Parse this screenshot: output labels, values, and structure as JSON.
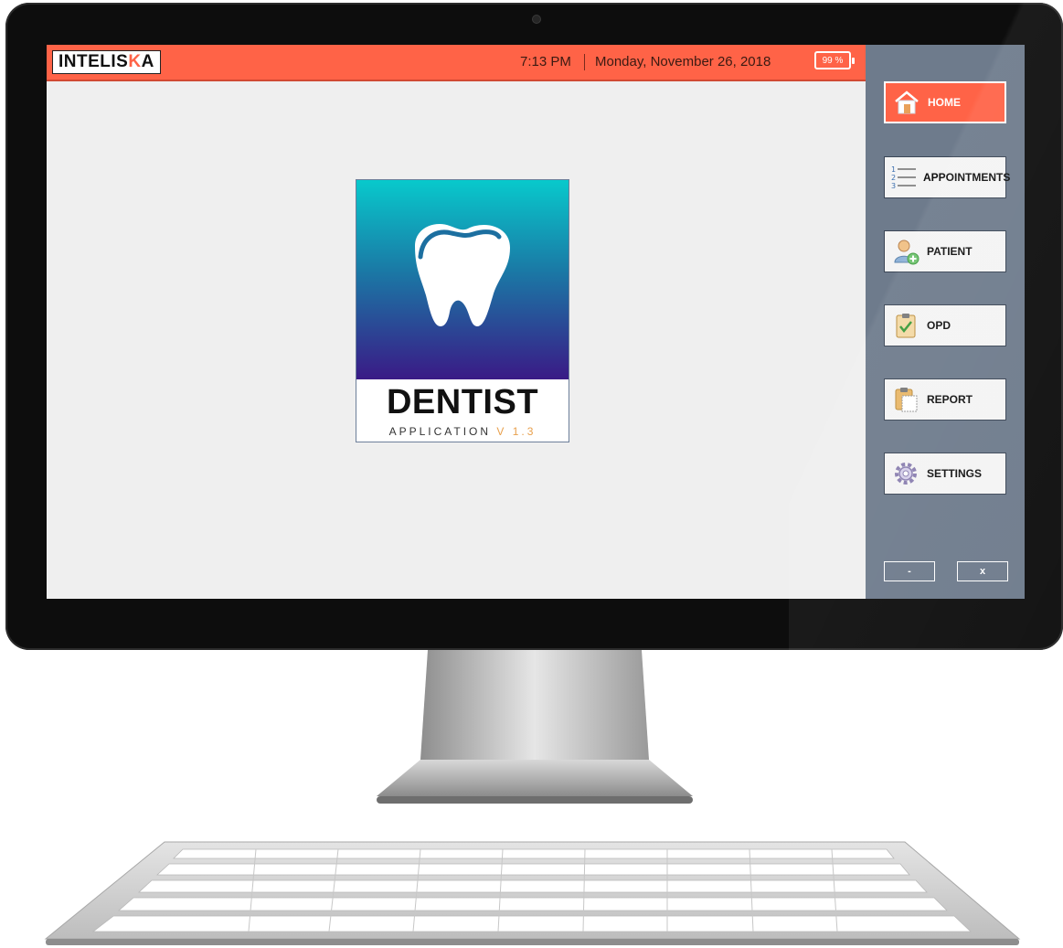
{
  "topbar": {
    "brand": "INTELISKA",
    "brand_prefix": "INTELIS",
    "brand_mark": "K",
    "brand_suffix": "A",
    "time": "7:13 PM",
    "date": "Monday, November 26, 2018",
    "battery": "99 %"
  },
  "splash": {
    "title": "DENTIST",
    "subtitle": "APPLICATION",
    "version": "V 1.3"
  },
  "sidebar": {
    "items": [
      {
        "label": "HOME",
        "icon": "home-icon",
        "active": true
      },
      {
        "label": "APPOINTMENTS",
        "icon": "numbered-list-icon",
        "active": false
      },
      {
        "label": "PATIENT",
        "icon": "add-user-icon",
        "active": false
      },
      {
        "label": "OPD",
        "icon": "clipboard-check-icon",
        "active": false
      },
      {
        "label": "REPORT",
        "icon": "clipboard-report-icon",
        "active": false
      },
      {
        "label": "SETTINGS",
        "icon": "gear-icon",
        "active": false
      }
    ],
    "minimize": "-",
    "close": "x"
  },
  "colors": {
    "accent": "#ff6347",
    "sidebar": "#6e7b8c",
    "screen_bg": "#efefef"
  }
}
